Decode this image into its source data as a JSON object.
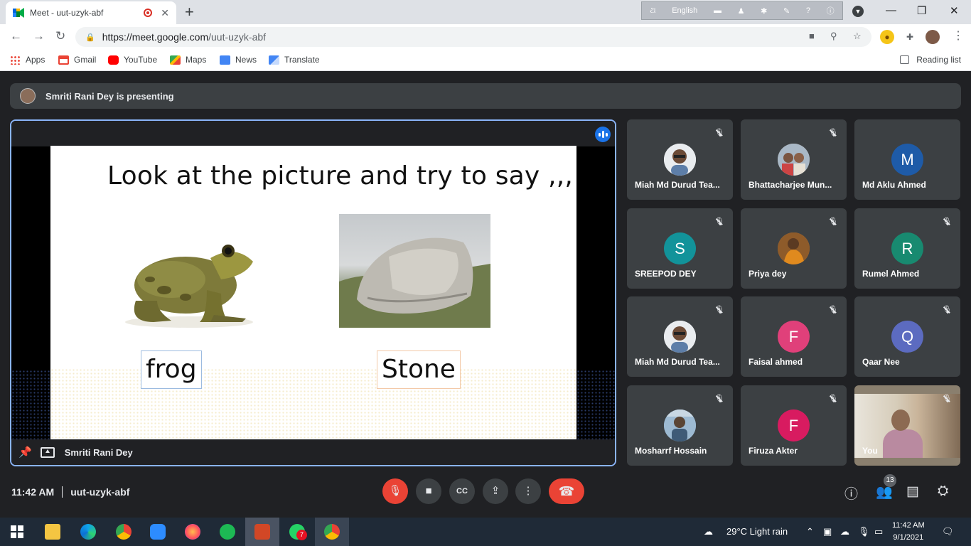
{
  "browser": {
    "tab_title": "Meet - uut-uzyk-abf",
    "url_host": "https://meet.google.com",
    "url_path": "/uut-uzyk-abf",
    "lang_bar_label": "English"
  },
  "bookmarks": [
    {
      "label": "Apps",
      "color": "#ea4335"
    },
    {
      "label": "Gmail",
      "color": "#ea4335"
    },
    {
      "label": "YouTube",
      "color": "#ff0000"
    },
    {
      "label": "Maps",
      "color": "#34a853"
    },
    {
      "label": "News",
      "color": "#4285f4"
    },
    {
      "label": "Translate",
      "color": "#4285f4"
    }
  ],
  "reading_list": "Reading list",
  "meet": {
    "presenting_text": "Smriti Rani Dey is presenting",
    "presenter_name": "Smriti Rani Dey",
    "slide": {
      "title": "Look at the picture and try to say ,,,",
      "word_left": "frog",
      "word_right": "Stone"
    },
    "participants": [
      {
        "name": "Miah Md Durud Tea...",
        "initial": "",
        "color": "#dfe3e6"
      },
      {
        "name": "Bhattacharjee Mun...",
        "initial": "",
        "color": "#b7a68e"
      },
      {
        "name": "Md Aklu Ahmed",
        "initial": "M",
        "color": "#1e5ba8"
      },
      {
        "name": "SREEPOD DEY",
        "initial": "S",
        "color": "#12939a"
      },
      {
        "name": "Priya dey",
        "initial": "",
        "color": "#b9773a"
      },
      {
        "name": "Rumel Ahmed",
        "initial": "R",
        "color": "#188a70"
      },
      {
        "name": "Miah Md Durud Tea...",
        "initial": "",
        "color": "#dfe3e6"
      },
      {
        "name": "Faisal ahmed",
        "initial": "F",
        "color": "#e0407a"
      },
      {
        "name": "Qaar Nee",
        "initial": "Q",
        "color": "#5c6bc0"
      },
      {
        "name": "Mosharrf Hossain",
        "initial": "",
        "color": "#7ea3c0"
      },
      {
        "name": "Firuza Akter",
        "initial": "F",
        "color": "#d81b60"
      },
      {
        "name": "You",
        "initial": "",
        "color": "#8a7f6e"
      }
    ],
    "time": "11:42 AM",
    "meeting_code": "uut-uzyk-abf",
    "participant_count": "13"
  },
  "taskbar": {
    "weather": "29°C  Light rain",
    "clock_time": "11:42 AM",
    "clock_date": "9/1/2021",
    "whatsapp_badge": "7"
  }
}
